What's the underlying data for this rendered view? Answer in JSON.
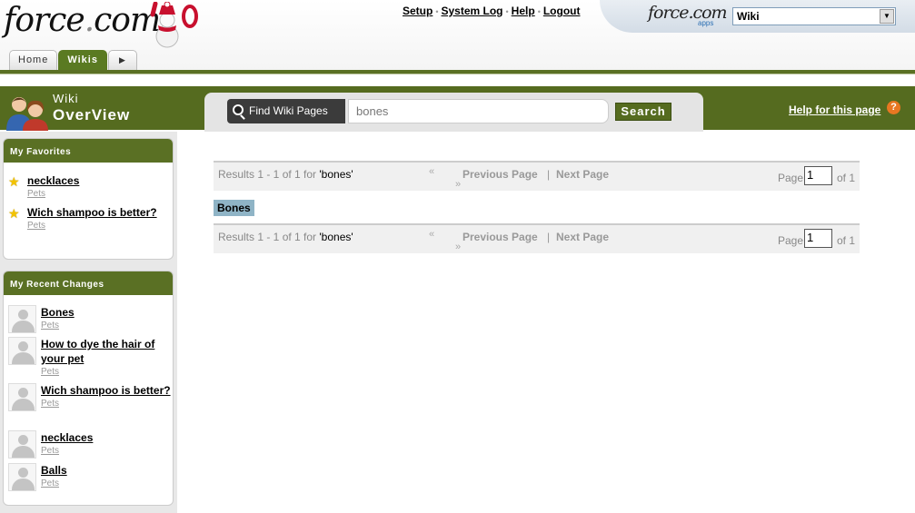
{
  "header": {
    "logo_text": "force",
    "logo_dot": ".",
    "logo_com": "com",
    "links": [
      "Setup",
      "System Log",
      "Help",
      "Logout"
    ],
    "apps_logo": "force.com",
    "apps_sub": "apps",
    "app_selected": "Wiki"
  },
  "tabs": [
    {
      "label": "Home",
      "active": false
    },
    {
      "label": "Wikis",
      "active": true
    }
  ],
  "page_header": {
    "small_title": "Wiki",
    "big_title": "OverView",
    "find_label": "Find Wiki Pages",
    "search_value": "bones",
    "search_button": "Search",
    "help_link": "Help for this page",
    "help_icon": "?"
  },
  "sidebar": {
    "favorites": {
      "title": "My Favorites",
      "items": [
        {
          "title": "necklaces",
          "category": "Pets"
        },
        {
          "title": "Wich shampoo is better?",
          "category": "Pets"
        }
      ]
    },
    "recent": {
      "title": "My Recent Changes",
      "items": [
        {
          "title": "Bones",
          "category": "Pets"
        },
        {
          "title": "How to dye the hair of your pet",
          "category": "Pets"
        },
        {
          "title": "Wich shampoo is better?",
          "category": "Pets"
        },
        {
          "title": "necklaces",
          "category": "Pets"
        },
        {
          "title": "Balls",
          "category": "Pets"
        }
      ]
    }
  },
  "results": {
    "count_text": "Results 1 - 1 of 1  for ",
    "query": "'bones'",
    "first_icon": "«",
    "last_icon": "»",
    "prev_label": "Previous Page",
    "pipe": "|",
    "next_label": "Next Page",
    "page_label": "Page",
    "page_value": "1",
    "of_label": "of 1",
    "items": [
      {
        "title": "Bones"
      }
    ]
  },
  "colors": {
    "brand_green": "#556b1f",
    "result_highlight": "#8fb4c6",
    "help_orange": "#e87722"
  }
}
